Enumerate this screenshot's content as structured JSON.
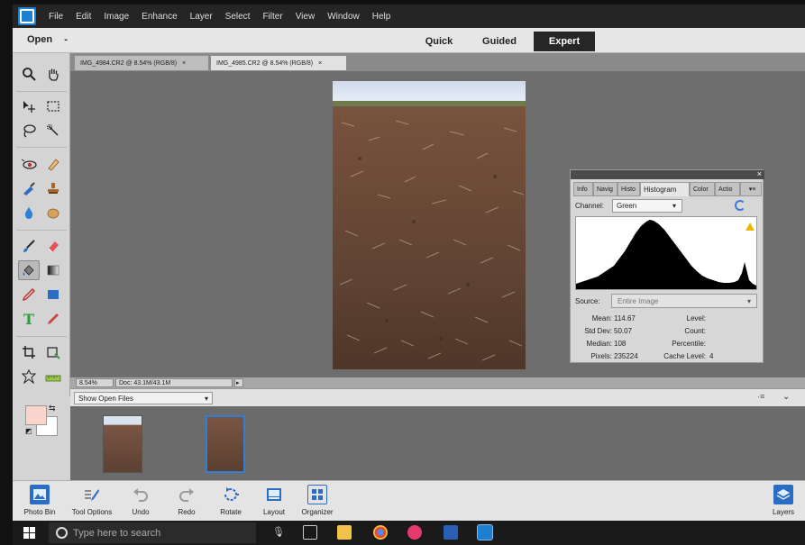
{
  "menu": {
    "items": [
      "File",
      "Edit",
      "Image",
      "Enhance",
      "Layer",
      "Select",
      "Filter",
      "View",
      "Window",
      "Help"
    ]
  },
  "modebar": {
    "open_label": "Open",
    "open_arrow": "-",
    "tabs": [
      "Quick",
      "Guided",
      "Expert"
    ]
  },
  "documents": {
    "tabs": [
      {
        "title": "IMG_4984.CR2 @ 8.54% (RGB/8)",
        "close": "×"
      },
      {
        "title": "IMG_4985.CR2 @ 8.54% (RGB/8)",
        "close": "×"
      }
    ]
  },
  "status": {
    "zoom": "8.54%",
    "doc_size": "Doc: 43.1M/43.1M"
  },
  "histogram": {
    "tabs": [
      "Info",
      "Navig",
      "Histo",
      "Histogram",
      "Color",
      "Actio"
    ],
    "close": "×",
    "channel_label": "Channel:",
    "channel_value": "Green",
    "source_label": "Source:",
    "source_value": "Entire Image",
    "stats_left": [
      {
        "label": "Mean:",
        "value": "114.67"
      },
      {
        "label": "Std Dev:",
        "value": "50.07"
      },
      {
        "label": "Median:",
        "value": "108"
      },
      {
        "label": "Pixels:",
        "value": "235224"
      }
    ],
    "stats_right": [
      {
        "label": "Level:",
        "value": ""
      },
      {
        "label": "Count:",
        "value": ""
      },
      {
        "label": "Percentile:",
        "value": ""
      },
      {
        "label": "Cache Level:",
        "value": "4"
      }
    ]
  },
  "filesbar": {
    "show_open_files": "Show Open Files"
  },
  "bottombar": {
    "items": [
      "Photo Bin",
      "Tool Options",
      "Undo",
      "Redo",
      "Rotate",
      "Layout",
      "Organizer",
      "Layers"
    ]
  },
  "taskbar": {
    "search_placeholder": "Type here to search"
  },
  "colors": {
    "accent": "#2f7fd8",
    "expert_tab": "#262626",
    "foreground_swatch": "#f9d5cc",
    "background_swatch": "#ffffff"
  }
}
